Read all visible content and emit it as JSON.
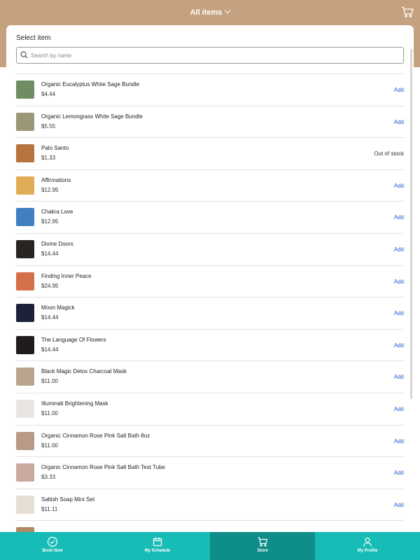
{
  "header": {
    "title": "All items"
  },
  "panel": {
    "select_label": "Select item",
    "search": {
      "placeholder": "Search by name",
      "value": ""
    }
  },
  "items": [
    {
      "name": "Organic Eucalyptus White Sage Bundle",
      "price": "$4.44",
      "action": "Add",
      "thumb": "#6f8c62"
    },
    {
      "name": "Organic Lemongrass White Sage Bundle",
      "price": "$5.55",
      "action": "Add",
      "thumb": "#9b9676"
    },
    {
      "name": "Palo Santo",
      "price": "$1.33",
      "action": "Out of stock",
      "thumb": "#b7743f"
    },
    {
      "name": "Affirmations",
      "price": "$12.95",
      "action": "Add",
      "thumb": "#e0ad56"
    },
    {
      "name": "Chakra Love",
      "price": "$12.95",
      "action": "Add",
      "thumb": "#3f7fc2"
    },
    {
      "name": "Divine Doors",
      "price": "$14.44",
      "action": "Add",
      "thumb": "#2a2420"
    },
    {
      "name": "Finding Inner Peace",
      "price": "$24.95",
      "action": "Add",
      "thumb": "#d46f4a"
    },
    {
      "name": "Moon Magick",
      "price": "$14.44",
      "action": "Add",
      "thumb": "#1c2238"
    },
    {
      "name": "The Language Of Flowers",
      "price": "$14.44",
      "action": "Add",
      "thumb": "#1f1b1e"
    },
    {
      "name": "Black Magic Detox Charcoal Mask",
      "price": "$11.00",
      "action": "Add",
      "thumb": "#b9a58d"
    },
    {
      "name": "Illuminati Brightening Mask",
      "price": "$11.00",
      "action": "Add",
      "thumb": "#e9e6e1"
    },
    {
      "name": "Organic Cinnamon Rose Pink Salt Bath 8oz",
      "price": "$11.00",
      "action": "Add",
      "thumb": "#b89a86"
    },
    {
      "name": "Organic Cinnamon Rose Pink Salt Bath Test Tube",
      "price": "$3.33",
      "action": "Add",
      "thumb": "#c9a9a0"
    },
    {
      "name": "Saltish Soap Mini Set",
      "price": "$11.11",
      "action": "Add",
      "thumb": "#e6ddd4"
    },
    {
      "name": "",
      "price": "",
      "action": "",
      "thumb": "#b08a66"
    }
  ],
  "bottom_nav": [
    {
      "label": "Book Now",
      "icon": "check-circle-icon",
      "active": false
    },
    {
      "label": "My Schedule",
      "icon": "calendar-icon",
      "active": false
    },
    {
      "label": "Store",
      "icon": "cart-icon",
      "active": true
    },
    {
      "label": "My Profile",
      "icon": "person-icon",
      "active": false
    }
  ],
  "colors": {
    "header_band": "#c5a17f",
    "nav_bar": "#18bcb7",
    "nav_active": "#0f8d88",
    "add_link": "#2a55c9"
  }
}
